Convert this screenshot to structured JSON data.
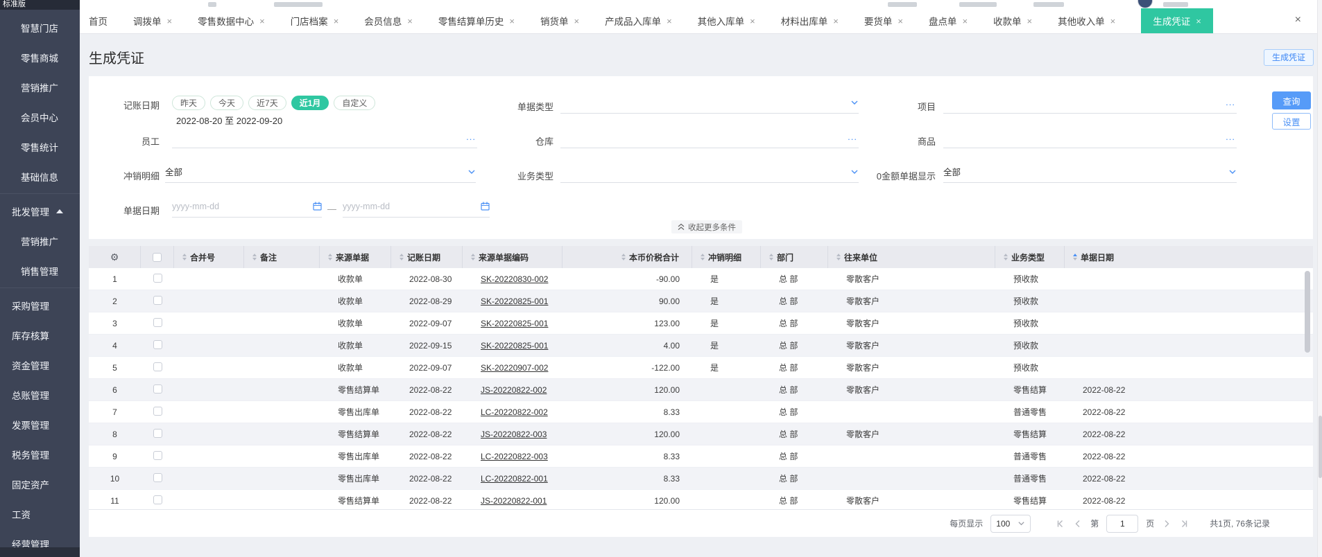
{
  "colors": {
    "accent_green": "#2fc7a1",
    "accent_blue": "#4a90f5",
    "sidebar_bg": "#3d4456",
    "query_button_bg": "#569bf8"
  },
  "sidebar": {
    "edition": "标准版",
    "items": [
      {
        "label": "智慧门店",
        "name": "smart-store",
        "indent": true
      },
      {
        "label": "零售商城",
        "name": "retail-mall",
        "indent": true
      },
      {
        "label": "营销推广",
        "name": "marketing-promotion",
        "indent": true
      },
      {
        "label": "会员中心",
        "name": "member-center",
        "indent": true
      },
      {
        "label": "零售统计",
        "name": "retail-statistics",
        "indent": true
      },
      {
        "label": "基础信息",
        "name": "basic-info",
        "indent": true
      },
      {
        "divider": true
      },
      {
        "label": "批发管理",
        "name": "wholesale-management",
        "caret": "up"
      },
      {
        "label": "营销推广",
        "name": "wholesale-marketing-promotion",
        "indent": true
      },
      {
        "label": "销售管理",
        "name": "sales-management",
        "indent": true
      },
      {
        "divider": true
      },
      {
        "label": "采购管理",
        "name": "purchase-management"
      },
      {
        "label": "库存核算",
        "name": "inventory-accounting"
      },
      {
        "label": "资金管理",
        "name": "funds-management"
      },
      {
        "label": "总账管理",
        "name": "general-ledger"
      },
      {
        "label": "发票管理",
        "name": "invoice-management"
      },
      {
        "label": "税务管理",
        "name": "tax-management"
      },
      {
        "label": "固定资产",
        "name": "fixed-assets"
      },
      {
        "label": "工资",
        "name": "payroll"
      },
      {
        "label": "经营管理",
        "name": "business-management"
      }
    ]
  },
  "tabs": {
    "items": [
      {
        "label": "首页",
        "name": "home",
        "closable": false,
        "active": false
      },
      {
        "label": "调拨单",
        "name": "transfer-order",
        "closable": true,
        "active": false
      },
      {
        "label": "零售数据中心",
        "name": "retail-data-center",
        "closable": true,
        "active": false
      },
      {
        "label": "门店档案",
        "name": "store-archive",
        "closable": true,
        "active": false
      },
      {
        "label": "会员信息",
        "name": "member-info",
        "closable": true,
        "active": false
      },
      {
        "label": "零售结算单历史",
        "name": "retail-settlement-history",
        "closable": true,
        "active": false
      },
      {
        "label": "销货单",
        "name": "sales-order",
        "closable": true,
        "active": false
      },
      {
        "label": "产成品入库单",
        "name": "finished-goods-inbound",
        "closable": true,
        "active": false
      },
      {
        "label": "其他入库单",
        "name": "other-inbound",
        "closable": true,
        "active": false
      },
      {
        "label": "材料出库单",
        "name": "material-outbound",
        "closable": true,
        "active": false
      },
      {
        "label": "要货单",
        "name": "goods-request",
        "closable": true,
        "active": false
      },
      {
        "label": "盘点单",
        "name": "stocktake",
        "closable": true,
        "active": false
      },
      {
        "label": "收款单",
        "name": "receipt-order",
        "closable": true,
        "active": false
      },
      {
        "label": "其他收入单",
        "name": "other-income",
        "closable": true,
        "active": false
      },
      {
        "label": "生成凭证",
        "name": "generate-voucher",
        "closable": true,
        "active": true
      }
    ]
  },
  "page": {
    "title": "生成凭证",
    "generate_button": "生成凭证"
  },
  "filters": {
    "accounting_date": {
      "label": "记账日期",
      "presets": [
        {
          "label": "昨天",
          "name": "yesterday",
          "selected": false
        },
        {
          "label": "今天",
          "name": "today",
          "selected": false
        },
        {
          "label": "近7天",
          "name": "last-7-days",
          "selected": false
        },
        {
          "label": "近1月",
          "name": "last-1-month",
          "selected": true
        },
        {
          "label": "自定义",
          "name": "custom",
          "selected": false
        }
      ],
      "range": "2022-08-20 至 2022-09-20"
    },
    "doc_type": {
      "label": "单据类型",
      "value": ""
    },
    "project": {
      "label": "项目",
      "value": ""
    },
    "employee": {
      "label": "员工",
      "value": ""
    },
    "warehouse": {
      "label": "仓库",
      "value": ""
    },
    "goods": {
      "label": "商品",
      "value": ""
    },
    "offset_detail": {
      "label": "冲销明细",
      "value": "全部"
    },
    "biz_type": {
      "label": "业务类型",
      "value": ""
    },
    "zero_amount": {
      "label": "0金额单据显示",
      "value": "全部"
    },
    "doc_date": {
      "label": "单据日期",
      "start_placeholder": "yyyy-mm-dd",
      "end_placeholder": "yyyy-mm-dd",
      "separator": "—"
    },
    "query_button": "查询",
    "settings_button": "设置",
    "collapse_button": "收起更多条件"
  },
  "table": {
    "columns": [
      {
        "label": "合并号",
        "name": "merge-no"
      },
      {
        "label": "备注",
        "name": "note"
      },
      {
        "label": "来源单据",
        "name": "source-doc"
      },
      {
        "label": "记账日期",
        "name": "accounting-date"
      },
      {
        "label": "来源单据编码",
        "name": "source-doc-code"
      },
      {
        "label": "本币价税合计",
        "name": "amount-incl-tax",
        "align": "right"
      },
      {
        "label": "冲销明细",
        "name": "offset-detail"
      },
      {
        "label": "部门",
        "name": "department"
      },
      {
        "label": "往来单位",
        "name": "counterparty"
      },
      {
        "label": "业务类型",
        "name": "business-type"
      },
      {
        "label": "单据日期",
        "name": "doc-date",
        "sorted": "asc"
      }
    ],
    "rows": [
      {
        "no": "1",
        "source": "收款单",
        "acct_date": "2022-08-30",
        "code": "SK-20220830-002",
        "amount": "-90.00",
        "offset": "是",
        "dept": "总 部",
        "partner": "零散客户",
        "biz_type": "预收款",
        "doc_date": ""
      },
      {
        "no": "2",
        "source": "收款单",
        "acct_date": "2022-08-29",
        "code": "SK-20220825-001",
        "amount": "90.00",
        "offset": "是",
        "dept": "总 部",
        "partner": "零散客户",
        "biz_type": "预收款",
        "doc_date": ""
      },
      {
        "no": "3",
        "source": "收款单",
        "acct_date": "2022-09-07",
        "code": "SK-20220825-001",
        "amount": "123.00",
        "offset": "是",
        "dept": "总 部",
        "partner": "零散客户",
        "biz_type": "预收款",
        "doc_date": ""
      },
      {
        "no": "4",
        "source": "收款单",
        "acct_date": "2022-09-15",
        "code": "SK-20220825-001",
        "amount": "4.00",
        "offset": "是",
        "dept": "总 部",
        "partner": "零散客户",
        "biz_type": "预收款",
        "doc_date": ""
      },
      {
        "no": "5",
        "source": "收款单",
        "acct_date": "2022-09-07",
        "code": "SK-20220907-002",
        "amount": "-122.00",
        "offset": "是",
        "dept": "总 部",
        "partner": "零散客户",
        "biz_type": "预收款",
        "doc_date": ""
      },
      {
        "no": "6",
        "source": "零售结算单",
        "acct_date": "2022-08-22",
        "code": "JS-20220822-002",
        "amount": "120.00",
        "offset": "",
        "dept": "总 部",
        "partner": "零散客户",
        "biz_type": "零售结算",
        "doc_date": "2022-08-22"
      },
      {
        "no": "7",
        "source": "零售出库单",
        "acct_date": "2022-08-22",
        "code": "LC-20220822-002",
        "amount": "8.33",
        "offset": "",
        "dept": "总 部",
        "partner": "",
        "biz_type": "普通零售",
        "doc_date": "2022-08-22"
      },
      {
        "no": "8",
        "source": "零售结算单",
        "acct_date": "2022-08-22",
        "code": "JS-20220822-003",
        "amount": "120.00",
        "offset": "",
        "dept": "总 部",
        "partner": "零散客户",
        "biz_type": "零售结算",
        "doc_date": "2022-08-22"
      },
      {
        "no": "9",
        "source": "零售出库单",
        "acct_date": "2022-08-22",
        "code": "LC-20220822-003",
        "amount": "8.33",
        "offset": "",
        "dept": "总 部",
        "partner": "",
        "biz_type": "普通零售",
        "doc_date": "2022-08-22"
      },
      {
        "no": "10",
        "source": "零售出库单",
        "acct_date": "2022-08-22",
        "code": "LC-20220822-001",
        "amount": "8.33",
        "offset": "",
        "dept": "总 部",
        "partner": "",
        "biz_type": "普通零售",
        "doc_date": "2022-08-22"
      },
      {
        "no": "11",
        "source": "零售结算单",
        "acct_date": "2022-08-22",
        "code": "JS-20220822-001",
        "amount": "120.00",
        "offset": "",
        "dept": "总 部",
        "partner": "零散客户",
        "biz_type": "零售结算",
        "doc_date": "2022-08-22"
      }
    ]
  },
  "pagination": {
    "per_page_label": "每页显示",
    "per_page": "100",
    "page_prefix": "第",
    "current_page": "1",
    "page_suffix": "页",
    "summary": "共1页, 76条记录"
  }
}
